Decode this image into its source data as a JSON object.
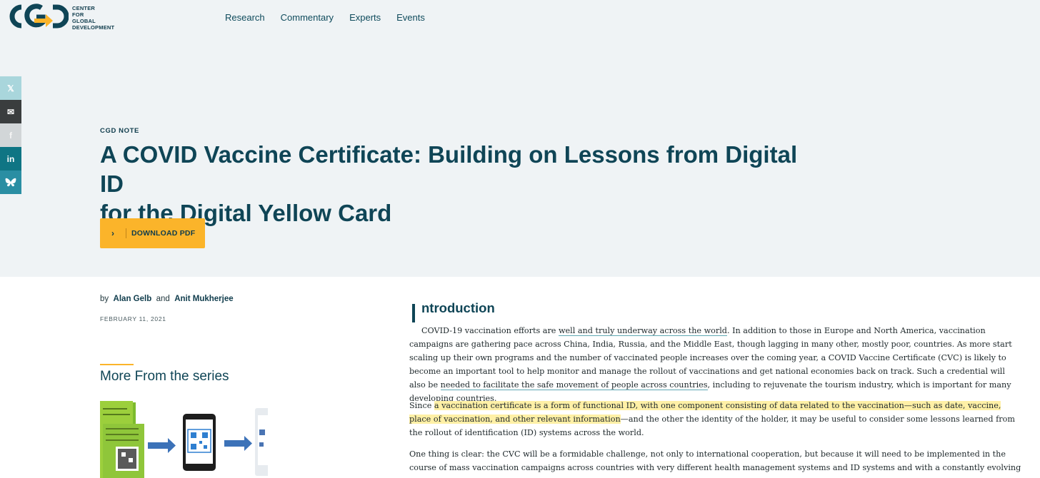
{
  "header": {
    "logo_lines": [
      "CENTER",
      "FOR",
      "GLOBAL",
      "DEVELOPMENT"
    ],
    "nav": [
      "Research",
      "Commentary",
      "Experts",
      "Events"
    ]
  },
  "share": {
    "icons": [
      "x-icon",
      "email-icon",
      "facebook-icon",
      "linkedin-icon",
      "bluesky-icon"
    ],
    "labels": [
      "𝕏",
      "✉",
      "f",
      "in",
      "🦋"
    ]
  },
  "hero": {
    "kicker": "CGD NOTE",
    "title_line1": "A COVID Vaccine Certificate: Building on Lessons from Digital ID",
    "title_line2": "for the Digital Yellow Card",
    "pdf_chevron": "›",
    "pdf_label": "DOWNLOAD PDF"
  },
  "meta": {
    "by": "by",
    "author1": "Alan Gelb",
    "and": "and",
    "author2": "Anit Mukherjee",
    "date": "FEBRUARY 11, 2021"
  },
  "series": {
    "title": "More From the series"
  },
  "article": {
    "heading": "ntroduction",
    "p1_a": "COVID-19 vaccination efforts are ",
    "p1_link1": "well and truly underway across the world",
    "p1_b": ". In addition to those in Europe and North America, vaccination campaigns are gathering pace across China, India, Russia, and the Middle East, though lagging in many other, mostly poor, countries. As more start scaling up their own programs and the number of vaccinated people increases over the coming year, a COVID Vaccine Certificate (CVC) is likely to become an important tool to help monitor and manage the rollout of vaccinations and get national economies back on track. Such a credential will also be ",
    "p1_link2": "needed to facilitate the safe movement of people across countries",
    "p1_c": ", including to rejuvenate the tourism industry, which is important for many developing countries.",
    "p2_a": "Since ",
    "p2_highlight": "a vaccination certificate is a form of functional ID, with one component consisting of data related to the vaccination—such as date, vaccine, place of vaccination, and other relevant information",
    "p2_b": "—and the other the identity of the holder, it may be useful to consider some lessons learned from the rollout of identification (ID) systems across the world.",
    "p3": "One thing is clear: the CVC will be a formidable challenge, not only to international cooperation, but because it will need to be implemented in the course of mass vaccination campaigns across countries with very different health management systems and ID systems and with a constantly evolving situation."
  },
  "colors": {
    "brand_teal": "#0f4556",
    "accent_yellow": "#fbb42a",
    "hero_bg": "#eff3f5",
    "highlight": "#fff0a6"
  }
}
